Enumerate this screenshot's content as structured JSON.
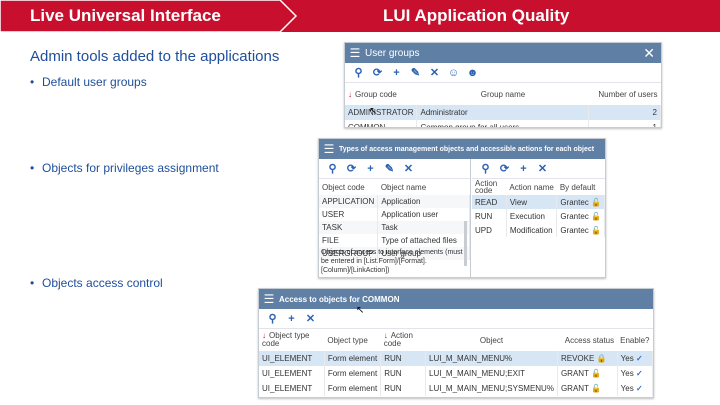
{
  "header": {
    "left_title": "Live Universal Interface",
    "right_title": "LUI Application Quality",
    "accent_color": "#c8102e"
  },
  "subtitle": "Admin tools added to the applications",
  "bullets": [
    "Default user groups",
    "Objects for privileges assignment",
    "Objects access control"
  ],
  "user_groups": {
    "title": "User groups",
    "columns": [
      "Group code",
      "Group name",
      "Number of users"
    ],
    "rows": [
      [
        "ADMINISTRATOR",
        "Administrator",
        "2"
      ],
      [
        "COMMON",
        "Common group for all users",
        "1"
      ]
    ]
  },
  "types": {
    "title": "Types of access management objects and accessible actions for each object",
    "left_columns": [
      "Object code",
      "Object name"
    ],
    "left_rows": [
      [
        "APPLICATION",
        "Application"
      ],
      [
        "USER",
        "Application user"
      ],
      [
        "TASK",
        "Task"
      ],
      [
        "FILE",
        "Type of attached files"
      ],
      [
        "USERGROUP",
        "User group"
      ]
    ],
    "right_columns": [
      "Action code",
      "Action name",
      "By default"
    ],
    "right_rows": [
      [
        "READ",
        "View",
        "Grantec"
      ],
      [
        "RUN",
        "Execution",
        "Grantec"
      ],
      [
        "UPD",
        "Modification",
        "Grantec"
      ]
    ],
    "note": "Objects of access to interface elements (must be entered in [List.Form]/[Format].[Column]/[LinkAction])"
  },
  "access": {
    "title": "Access to objects for COMMON",
    "columns": [
      "Object type code",
      "Object type",
      "Action code",
      "Object",
      "Access status",
      "Enable?"
    ],
    "rows": [
      [
        "UI_ELEMENT",
        "Form element",
        "RUN",
        "LUI_M_MAIN_MENU%",
        "REVOKE",
        "Yes"
      ],
      [
        "UI_ELEMENT",
        "Form element",
        "RUN",
        "LUI_M_MAIN_MENU;EXIT",
        "GRANT",
        "Yes"
      ],
      [
        "UI_ELEMENT",
        "Form element",
        "RUN",
        "LUI_M_MAIN_MENU;SYSMENU%",
        "GRANT",
        "Yes"
      ]
    ]
  },
  "icons": [
    "menu-icon",
    "close-icon",
    "search-icon",
    "refresh-icon",
    "add-icon",
    "edit-icon",
    "delete-icon",
    "lock-icon",
    "check-icon"
  ]
}
